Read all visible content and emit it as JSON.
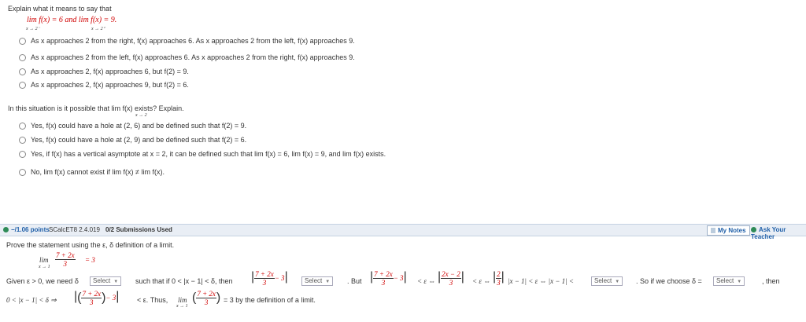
{
  "q1": {
    "prompt": "Explain what it means to say that",
    "limit_statement": "lim f(x) = 6 and lim f(x) = 9.",
    "lim_left_sub": "x → 2⁻",
    "lim_right_sub": "x → 2⁺",
    "options": [
      "As x approaches 2 from the right, f(x) approaches 6. As x approaches 2 from the left, f(x) approaches 9.",
      "As x approaches 2 from the left, f(x) approaches 6. As x approaches 2 from the right, f(x) approaches 9.",
      "As x approaches 2, f(x) approaches 6, but f(2) = 9.",
      "As x approaches 2, f(x) approaches 9, but f(2) = 6."
    ]
  },
  "q2": {
    "prompt": "In this situation is it possible that lim f(x) exists? Explain.",
    "lim_sub": "x → 2",
    "options": [
      "Yes, f(x) could have a hole at (2, 6) and be defined such that f(2) = 9.",
      "Yes, f(x) could have a hole at (2, 9) and be defined such that f(2) = 6.",
      "Yes, if f(x) has a vertical asymptote at x = 2, it can be defined such that lim f(x) = 6, lim f(x) = 9, and lim f(x) exists.",
      "No, lim f(x) cannot exist if lim f(x) ≠ lim f(x)."
    ]
  },
  "header_bar": {
    "points": "−/1.06 points",
    "code": "SCalcET8 2.4.019",
    "submissions": "0/2 Submissions Used",
    "my_notes": "My Notes",
    "ask_teacher": "Ask Your Teacher"
  },
  "q3": {
    "prompt": "Prove the statement using the ε, δ definition of a limit.",
    "lim_sub": "x → 1",
    "frac_num": "7 + 2x",
    "frac_den": "3",
    "equals": "= 3",
    "given": "Given ε > 0, we need δ",
    "such_that": "such that if 0 < |x − 1| < δ, then",
    "but": ". But",
    "chain": "< ε ⇔",
    "chain_num": "2x − 2",
    "chain_den": "3",
    "chain2_num": "2",
    "chain2_den": "3",
    "chain3": "|x − 1| < ε ⇔ |x − 1| <",
    "so_if": ". So if we choose δ =",
    "then": ", then",
    "line2_start": "0 < |x − 1| < δ ⇒",
    "line2_mid": "< ε. Thus,",
    "line2_end": "= 3 by the definition of a limit.",
    "minus3": "− 3",
    "select_label": "Select"
  }
}
